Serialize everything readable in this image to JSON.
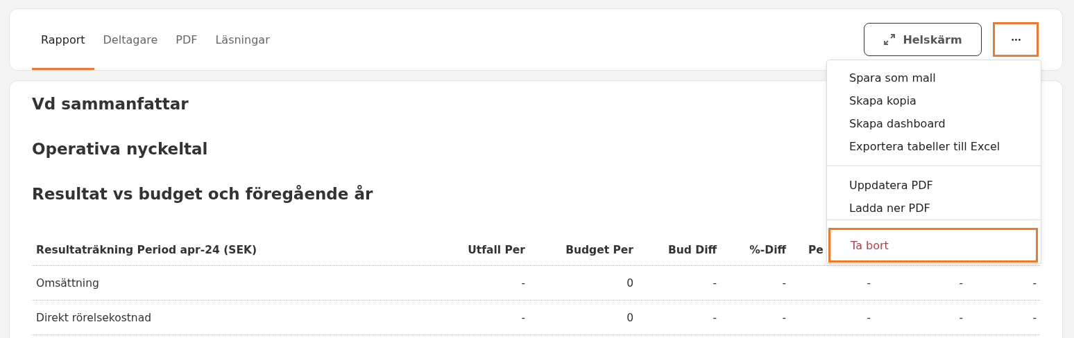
{
  "tabs": [
    {
      "label": "Rapport",
      "selected": true
    },
    {
      "label": "Deltagare",
      "selected": false
    },
    {
      "label": "PDF",
      "selected": false
    },
    {
      "label": "Läsningar",
      "selected": false
    }
  ],
  "fullscreen_button": {
    "label": "Helskärm"
  },
  "more_button": {
    "label": "•••",
    "highlighted": true
  },
  "menu": {
    "groups": [
      [
        {
          "label": "Spara som mall",
          "kind": "normal",
          "highlighted": false
        },
        {
          "label": "Skapa kopia",
          "kind": "normal",
          "highlighted": false
        },
        {
          "label": "Skapa dashboard",
          "kind": "normal",
          "highlighted": false
        },
        {
          "label": "Exportera tabeller till Excel",
          "kind": "normal",
          "highlighted": false
        }
      ],
      [
        {
          "label": "Uppdatera PDF",
          "kind": "normal",
          "highlighted": false
        },
        {
          "label": "Ladda ner PDF",
          "kind": "normal",
          "highlighted": false
        }
      ],
      [
        {
          "label": "Ta bort",
          "kind": "danger",
          "highlighted": true
        }
      ]
    ]
  },
  "headings": [
    "Vd sammanfattar",
    "Operativa nyckeltal",
    "Resultat vs budget och föregående år"
  ],
  "table": {
    "columns": [
      "Resultaträkning Period apr-24 (SEK)",
      "Utfall Per",
      "Budget Per",
      "Bud Diff",
      "%-Diff",
      "Pe"
    ],
    "rows": [
      [
        "Omsättning",
        "-",
        "0",
        "-",
        "-",
        "-",
        "-",
        "-"
      ],
      [
        "Direkt rörelsekostnad",
        "-",
        "0",
        "-",
        "-",
        "-",
        "-",
        "-"
      ]
    ]
  }
}
